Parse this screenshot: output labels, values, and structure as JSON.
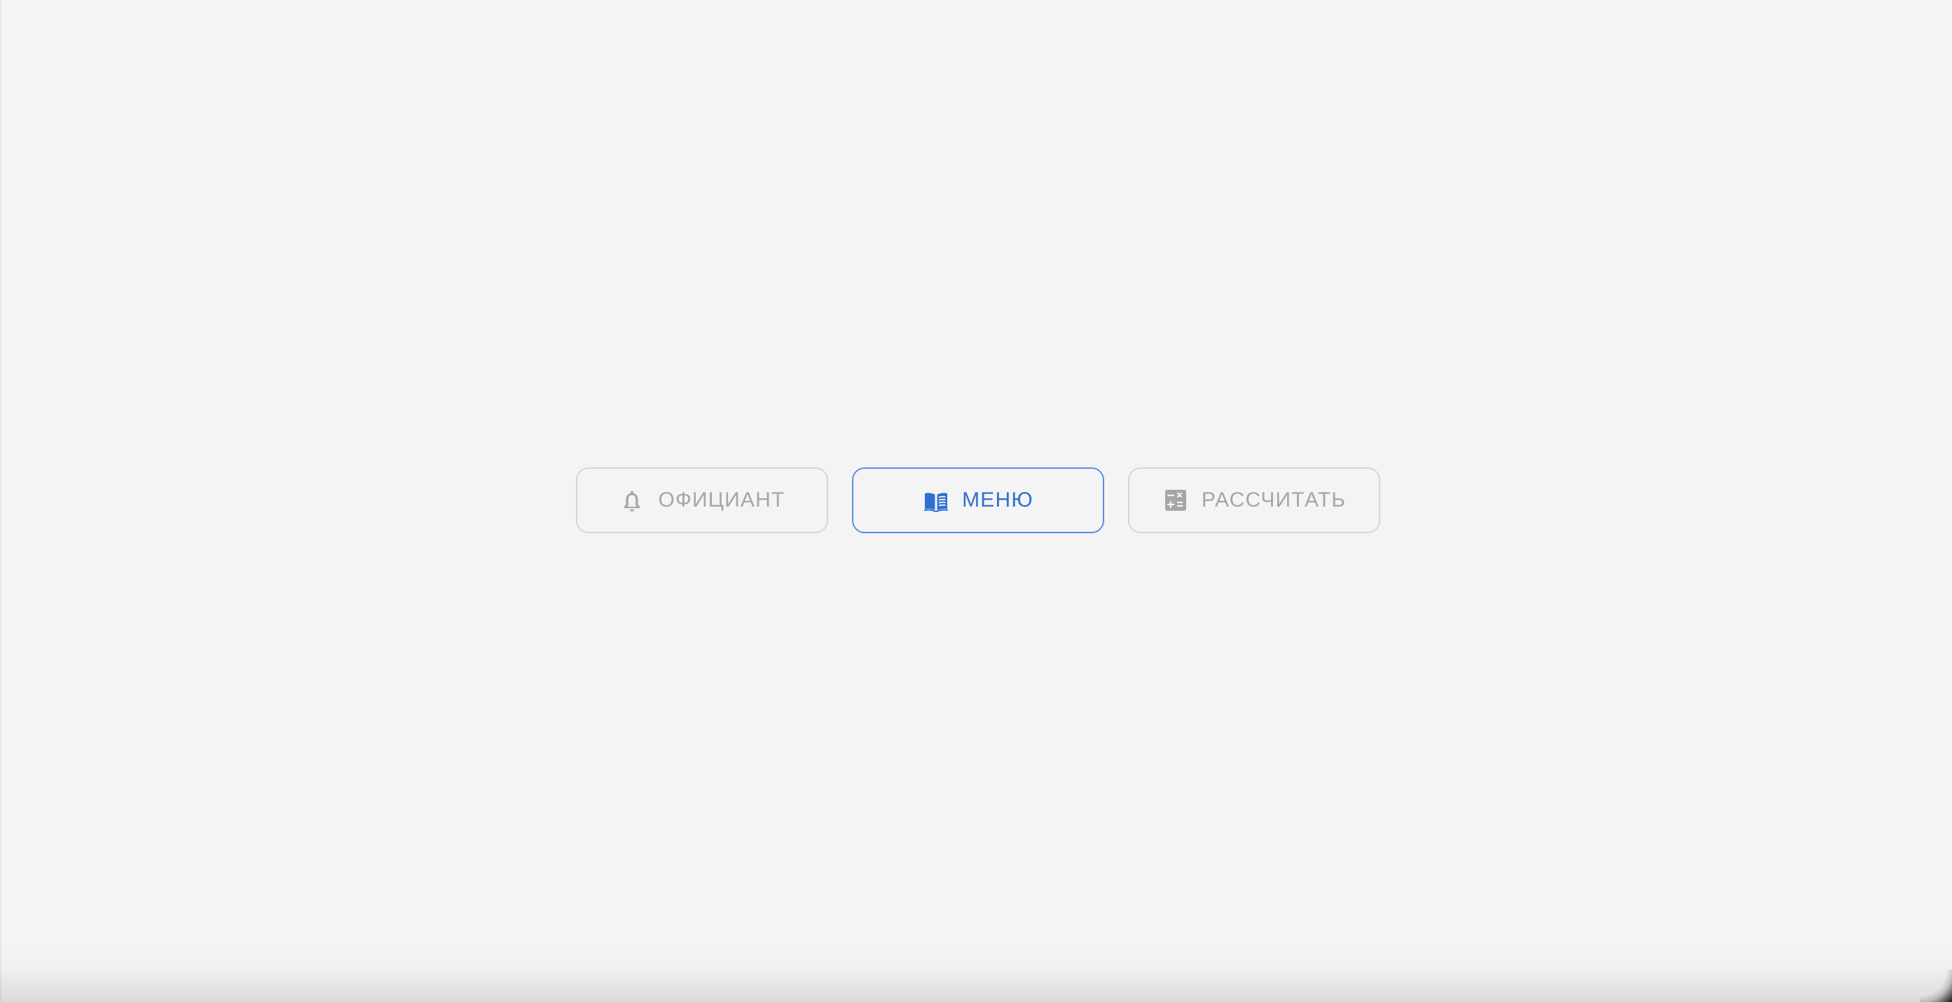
{
  "actions": {
    "waiter": {
      "label": "ОФИЦИАНТ",
      "icon": "bell-icon",
      "state": "inactive"
    },
    "menu": {
      "label": "МЕНЮ",
      "icon": "open-book-icon",
      "state": "active"
    },
    "calculate": {
      "label": "РАССЧИТАТЬ",
      "icon": "calculator-icon",
      "state": "inactive"
    }
  },
  "colors": {
    "background": "#f4f4f4",
    "inactive_border": "#d5d5d5",
    "inactive_text": "#a6a6a6",
    "active_border": "#5b8ee3",
    "active_text": "#2f6fd2"
  }
}
